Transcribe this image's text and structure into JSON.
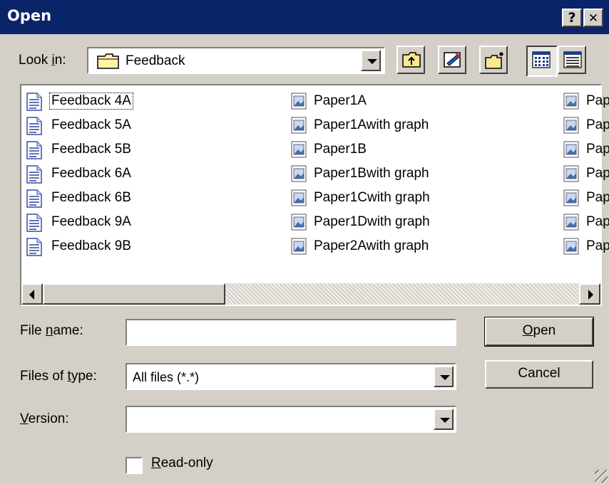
{
  "window": {
    "title": "Open"
  },
  "titlebar_buttons": {
    "help": "?",
    "close": "✕"
  },
  "lookin": {
    "label": "Look in:",
    "value": "Feedback"
  },
  "toolbar": {
    "icons": [
      "up-one-level-icon",
      "desktop-icon",
      "create-new-folder-icon",
      "list-view-icon",
      "details-view-icon"
    ]
  },
  "files": {
    "col1": [
      "Feedback 4A",
      "Feedback 5A",
      "Feedback 5B",
      "Feedback 6A",
      "Feedback 6B",
      "Feedback 9A",
      "Feedback 9B"
    ],
    "col2": [
      "Paper1A",
      "Paper1Awith graph",
      "Paper1B",
      "Paper1Bwith graph",
      "Paper1Cwith graph",
      "Paper1Dwith graph",
      "Paper2Awith graph"
    ],
    "col3": [
      "Pap",
      "Pap",
      "Pap",
      "Pap",
      "Pap",
      "Pap",
      "Pap"
    ]
  },
  "form": {
    "filename_label": "File name:",
    "filename_value": "",
    "filetype_label": "Files of type:",
    "filetype_value": "All files (*.*)",
    "version_label": "Version:",
    "version_value": "",
    "readonly_label": "Read-only",
    "readonly_checked": false
  },
  "buttons": {
    "open": "Open",
    "cancel": "Cancel"
  },
  "colors": {
    "titlebar": "#0a246a",
    "face": "#d4d0c8",
    "field": "#ffffff"
  }
}
